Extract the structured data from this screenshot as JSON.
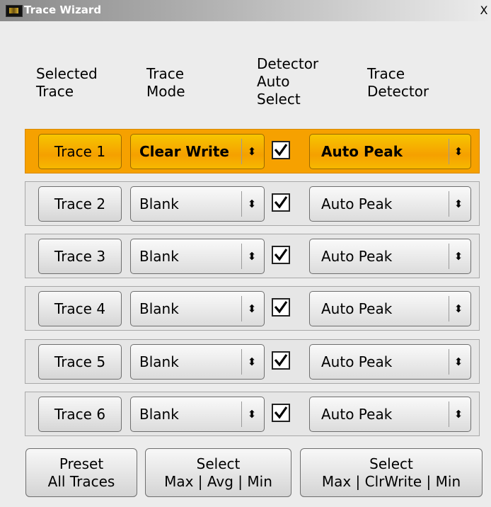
{
  "window": {
    "title": "Trace Wizard",
    "close_label": "X"
  },
  "headers": {
    "selected_trace": "Selected\nTrace",
    "trace_mode": "Trace\nMode",
    "detector_auto_select": "Detector\nAuto\nSelect",
    "trace_detector": "Trace\nDetector"
  },
  "rows": [
    {
      "trace": "Trace 1",
      "mode": "Clear Write",
      "auto_select": true,
      "detector": "Auto Peak",
      "selected": true
    },
    {
      "trace": "Trace 2",
      "mode": "Blank",
      "auto_select": true,
      "detector": "Auto Peak",
      "selected": false
    },
    {
      "trace": "Trace 3",
      "mode": "Blank",
      "auto_select": true,
      "detector": "Auto Peak",
      "selected": false
    },
    {
      "trace": "Trace 4",
      "mode": "Blank",
      "auto_select": true,
      "detector": "Auto Peak",
      "selected": false
    },
    {
      "trace": "Trace 5",
      "mode": "Blank",
      "auto_select": true,
      "detector": "Auto Peak",
      "selected": false
    },
    {
      "trace": "Trace 6",
      "mode": "Blank",
      "auto_select": true,
      "detector": "Auto Peak",
      "selected": false
    }
  ],
  "bottom_buttons": [
    {
      "line1": "Preset",
      "line2": "All Traces"
    },
    {
      "line1": "Select",
      "line2": "Max | Avg | Min"
    },
    {
      "line1": "Select",
      "line2": "Max | ClrWrite | Min"
    }
  ],
  "colors": {
    "selected_row": "#f6a100",
    "title_bar": "#8a8a8a"
  },
  "icons": {
    "dropdown": "up-down-arrows-icon",
    "checkbox": "checkmark-icon",
    "app": "trace-wizard-app-icon"
  }
}
